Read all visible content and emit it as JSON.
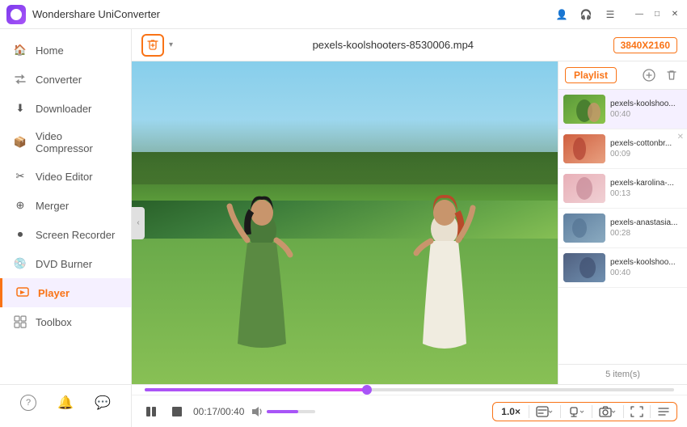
{
  "app": {
    "title": "Wondershare UniConverter",
    "logo_alt": "app-logo"
  },
  "titlebar": {
    "profile_icon": "👤",
    "headset_icon": "🎧",
    "menu_icon": "☰",
    "minimize": "—",
    "maximize": "□",
    "close": "✕"
  },
  "sidebar": {
    "items": [
      {
        "id": "home",
        "label": "Home",
        "icon": "🏠"
      },
      {
        "id": "converter",
        "label": "Converter",
        "icon": "↔"
      },
      {
        "id": "downloader",
        "label": "Downloader",
        "icon": "⬇"
      },
      {
        "id": "video-compressor",
        "label": "Video Compressor",
        "icon": "📦"
      },
      {
        "id": "video-editor",
        "label": "Video Editor",
        "icon": "✂"
      },
      {
        "id": "merger",
        "label": "Merger",
        "icon": "⊕"
      },
      {
        "id": "screen-recorder",
        "label": "Screen Recorder",
        "icon": "⏺"
      },
      {
        "id": "dvd-burner",
        "label": "DVD Burner",
        "icon": "💿"
      },
      {
        "id": "player",
        "label": "Player",
        "icon": "▶",
        "active": true
      },
      {
        "id": "toolbox",
        "label": "Toolbox",
        "icon": "⚙"
      }
    ],
    "bottom": [
      {
        "id": "help",
        "icon": "?"
      },
      {
        "id": "bell",
        "icon": "🔔"
      },
      {
        "id": "feedback",
        "icon": "💬"
      }
    ]
  },
  "video_header": {
    "add_btn_label": "+",
    "filename": "pexels-koolshooters-8530006.mp4",
    "resolution": "3840X2160"
  },
  "playlist": {
    "tab_label": "Playlist",
    "items": [
      {
        "id": 1,
        "name": "pexels-koolshoo...",
        "duration": "00:40",
        "thumb_class": "thumb-1"
      },
      {
        "id": 2,
        "name": "pexels-cottonbr...",
        "duration": "00:09",
        "thumb_class": "thumb-2"
      },
      {
        "id": 3,
        "name": "pexels-karolina-...",
        "duration": "00:13",
        "thumb_class": "thumb-3"
      },
      {
        "id": 4,
        "name": "pexels-anastasia...",
        "duration": "00:28",
        "thumb_class": "thumb-4"
      },
      {
        "id": 5,
        "name": "pexels-koolshoo...",
        "duration": "00:40",
        "thumb_class": "thumb-5"
      }
    ],
    "count_label": "5 item(s)"
  },
  "player": {
    "progress_pct": 42,
    "current_time": "00:17",
    "total_time": "00:40",
    "time_display": "00:17/00:40",
    "speed": "1.0×",
    "volume_pct": 65
  },
  "controls": {
    "play_pause": "⏸",
    "stop": "⏹",
    "volume_icon": "🔈",
    "speed_label": "1.0×",
    "font_icon": "T",
    "audio_icon": "♪",
    "screenshot_icon": "📷",
    "fullscreen_icon": "⛶",
    "playlist_icon": "☰"
  }
}
